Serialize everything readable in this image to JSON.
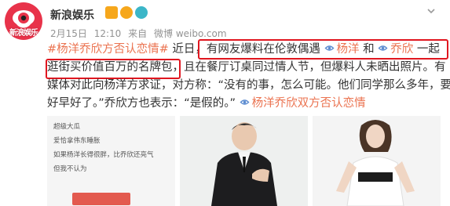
{
  "account": {
    "name": "新浪娱乐",
    "avatar_brand": "新浪娱乐"
  },
  "meta": {
    "date": "2月15日",
    "time": "12:10",
    "from_label": "来自",
    "source": "微博 weibo.com"
  },
  "post": {
    "lines": [
      [
        {
          "type": "link",
          "text": "#杨洋乔欣方否认恋情#"
        },
        {
          "type": "text",
          "text": " 近日，"
        },
        {
          "type": "text",
          "text": "有网友爆料在伦敦偶遇 "
        },
        {
          "type": "mention",
          "text": "杨洋"
        },
        {
          "type": "text",
          "text": " 和 "
        },
        {
          "type": "mention",
          "text": "乔欣"
        },
        {
          "type": "text",
          "text": " 一起"
        }
      ],
      [
        {
          "type": "text",
          "text": "逛街买价值百万的名牌包"
        },
        {
          "type": "text",
          "text": "，且在餐厅订桌同过情人节，但爆料人未晒出照片。有"
        }
      ],
      [
        {
          "type": "text",
          "text": "媒体对此向杨洋方求证，对方称：“没有的事，怎么可能。他们同学那么多年，要"
        }
      ],
      [
        {
          "type": "text",
          "text": "好早好了。”乔欣方也表示：“是假的。” "
        },
        {
          "type": "mention",
          "text": "杨洋乔欣双方否认恋情"
        }
      ]
    ]
  },
  "gallery": {
    "chat_lines": [
      "超级大瓜",
      "爱恰拿伟东睡胀",
      "如果杨洋长得很胖，比乔欣还亮气",
      "但我不认为"
    ]
  },
  "colors": {
    "link": "#eb7350",
    "highlight": "#e0161f",
    "text": "#333333",
    "meta": "#939393"
  }
}
